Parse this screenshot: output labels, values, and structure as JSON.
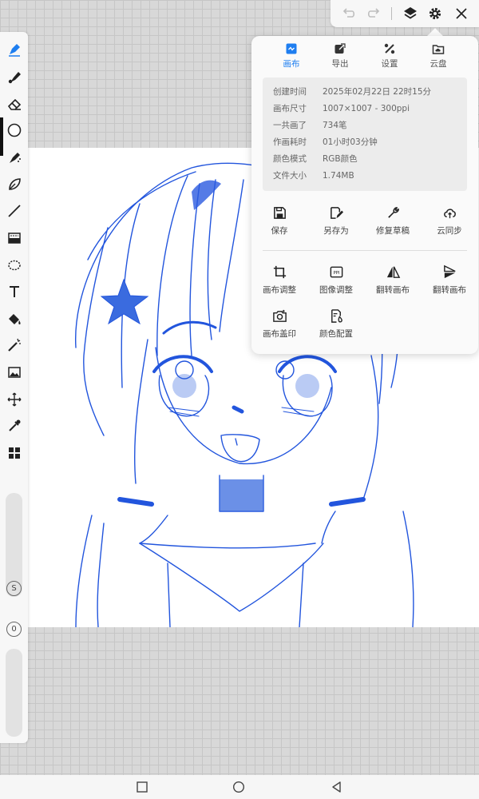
{
  "toolbar_left": {
    "tools": [
      "pen-brush-icon",
      "marker-icon",
      "eraser-icon",
      "color-circle-icon",
      "airbrush-icon",
      "leaf-brush-icon",
      "line-icon",
      "gradient-icon",
      "lasso-icon",
      "text-icon",
      "fill-bucket-icon",
      "magic-wand-icon",
      "image-icon",
      "transform-move-icon",
      "eyedropper-icon",
      "layers-grid-icon"
    ],
    "size_badge": "S",
    "opacity_badge": "0",
    "active_color": "#000000"
  },
  "toolbar_top": {
    "icons": [
      "undo-icon",
      "redo-icon",
      "layers-icon",
      "gear-icon",
      "close-icon"
    ]
  },
  "settings_panel": {
    "tabs": [
      {
        "label": "画布",
        "icon": "canvas-icon",
        "active": true
      },
      {
        "label": "导出",
        "icon": "export-icon",
        "active": false
      },
      {
        "label": "设置",
        "icon": "settings-tools-icon",
        "active": false
      },
      {
        "label": "云盘",
        "icon": "cloud-drive-icon",
        "active": false
      }
    ],
    "info": [
      {
        "key": "创建时间",
        "value": "2025年02月22日 22时15分"
      },
      {
        "key": "画布尺寸",
        "value": "1007×1007 - 300ppi"
      },
      {
        "key": "一共画了",
        "value": "734笔"
      },
      {
        "key": "作画耗时",
        "value": "01小时03分钟"
      },
      {
        "key": "颜色模式",
        "value": "RGB颜色"
      },
      {
        "key": "文件大小",
        "value": "1.74MB"
      }
    ],
    "actions_row1": [
      {
        "label": "保存",
        "icon": "save-icon"
      },
      {
        "label": "另存为",
        "icon": "save-as-icon"
      },
      {
        "label": "修复草稿",
        "icon": "wrench-icon"
      },
      {
        "label": "云同步",
        "icon": "cloud-sync-icon"
      }
    ],
    "actions_row2": [
      {
        "label": "画布调整",
        "icon": "crop-icon"
      },
      {
        "label": "图像调整",
        "icon": "ppi-icon"
      },
      {
        "label": "翻转画布",
        "icon": "flip-horizontal-icon"
      },
      {
        "label": "翻转画布",
        "icon": "flip-vertical-icon"
      }
    ],
    "actions_row3": [
      {
        "label": "画布盖印",
        "icon": "camera-stamp-icon"
      },
      {
        "label": "颜色配置",
        "icon": "color-profile-icon"
      }
    ]
  },
  "nav_bar": {
    "icons": [
      "recent-apps-icon",
      "home-icon",
      "back-icon"
    ]
  },
  "colors": {
    "accent": "#1e7ef0",
    "sketch": "#2255dd"
  }
}
